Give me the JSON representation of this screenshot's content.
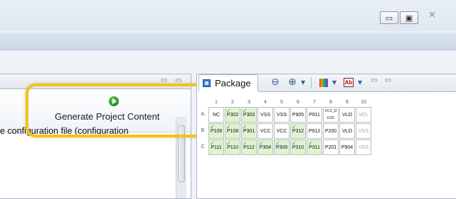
{
  "window": {
    "minimize_glyph": "▭",
    "maximize_glyph": "▣",
    "close_glyph": "✕"
  },
  "left_view": {
    "minimize_glyph": "▭",
    "maximize_glyph": "▭",
    "generate_label": "Generate Project Content",
    "config_text": "e configuration file (configuration"
  },
  "package_view": {
    "tab_label": "Package",
    "tools": {
      "zoom_out": "⊖",
      "zoom_in": "⊕",
      "dropdown": "▾"
    },
    "columns": [
      "1",
      "2",
      "3",
      "4",
      "5",
      "6",
      "7",
      "8",
      "9",
      "10"
    ],
    "rows": [
      {
        "label": "A",
        "pins": [
          {
            "name": "NC",
            "state": "plain"
          },
          {
            "name": "P302",
            "state": "green"
          },
          {
            "name": "P303",
            "state": "green"
          },
          {
            "name": "VSS",
            "state": "plain"
          },
          {
            "name": "VSS",
            "state": "plain"
          },
          {
            "name": "P905",
            "state": "plain"
          },
          {
            "name": "P911",
            "state": "plain"
          },
          {
            "name": "VCC_DCDC",
            "state": "plain"
          },
          {
            "name": "VLO",
            "state": "plain"
          },
          {
            "name": "VCL",
            "state": "dim"
          }
        ]
      },
      {
        "label": "B",
        "pins": [
          {
            "name": "P109",
            "state": "green"
          },
          {
            "name": "P108",
            "state": "green"
          },
          {
            "name": "P301",
            "state": "green"
          },
          {
            "name": "VCC",
            "state": "plain"
          },
          {
            "name": "VCC",
            "state": "plain"
          },
          {
            "name": "P312",
            "state": "green"
          },
          {
            "name": "P912",
            "state": "plain"
          },
          {
            "name": "P200",
            "state": "plain"
          },
          {
            "name": "VLO",
            "state": "plain"
          },
          {
            "name": "VSS",
            "state": "dim"
          }
        ]
      },
      {
        "label": "C",
        "pins": [
          {
            "name": "P111",
            "state": "green"
          },
          {
            "name": "P110",
            "state": "green"
          },
          {
            "name": "P112",
            "state": "green"
          },
          {
            "name": "P304",
            "state": "green"
          },
          {
            "name": "P309",
            "state": "green"
          },
          {
            "name": "P310",
            "state": "green"
          },
          {
            "name": "P311",
            "state": "green"
          },
          {
            "name": "P201",
            "state": "plain"
          },
          {
            "name": "P904",
            "state": "plain"
          },
          {
            "name": "VSS",
            "state": "dim"
          }
        ]
      }
    ]
  },
  "colors": {
    "highlight": "#f2c21a",
    "assigned_pin": "#dff3d2",
    "check": "#35a02f"
  }
}
